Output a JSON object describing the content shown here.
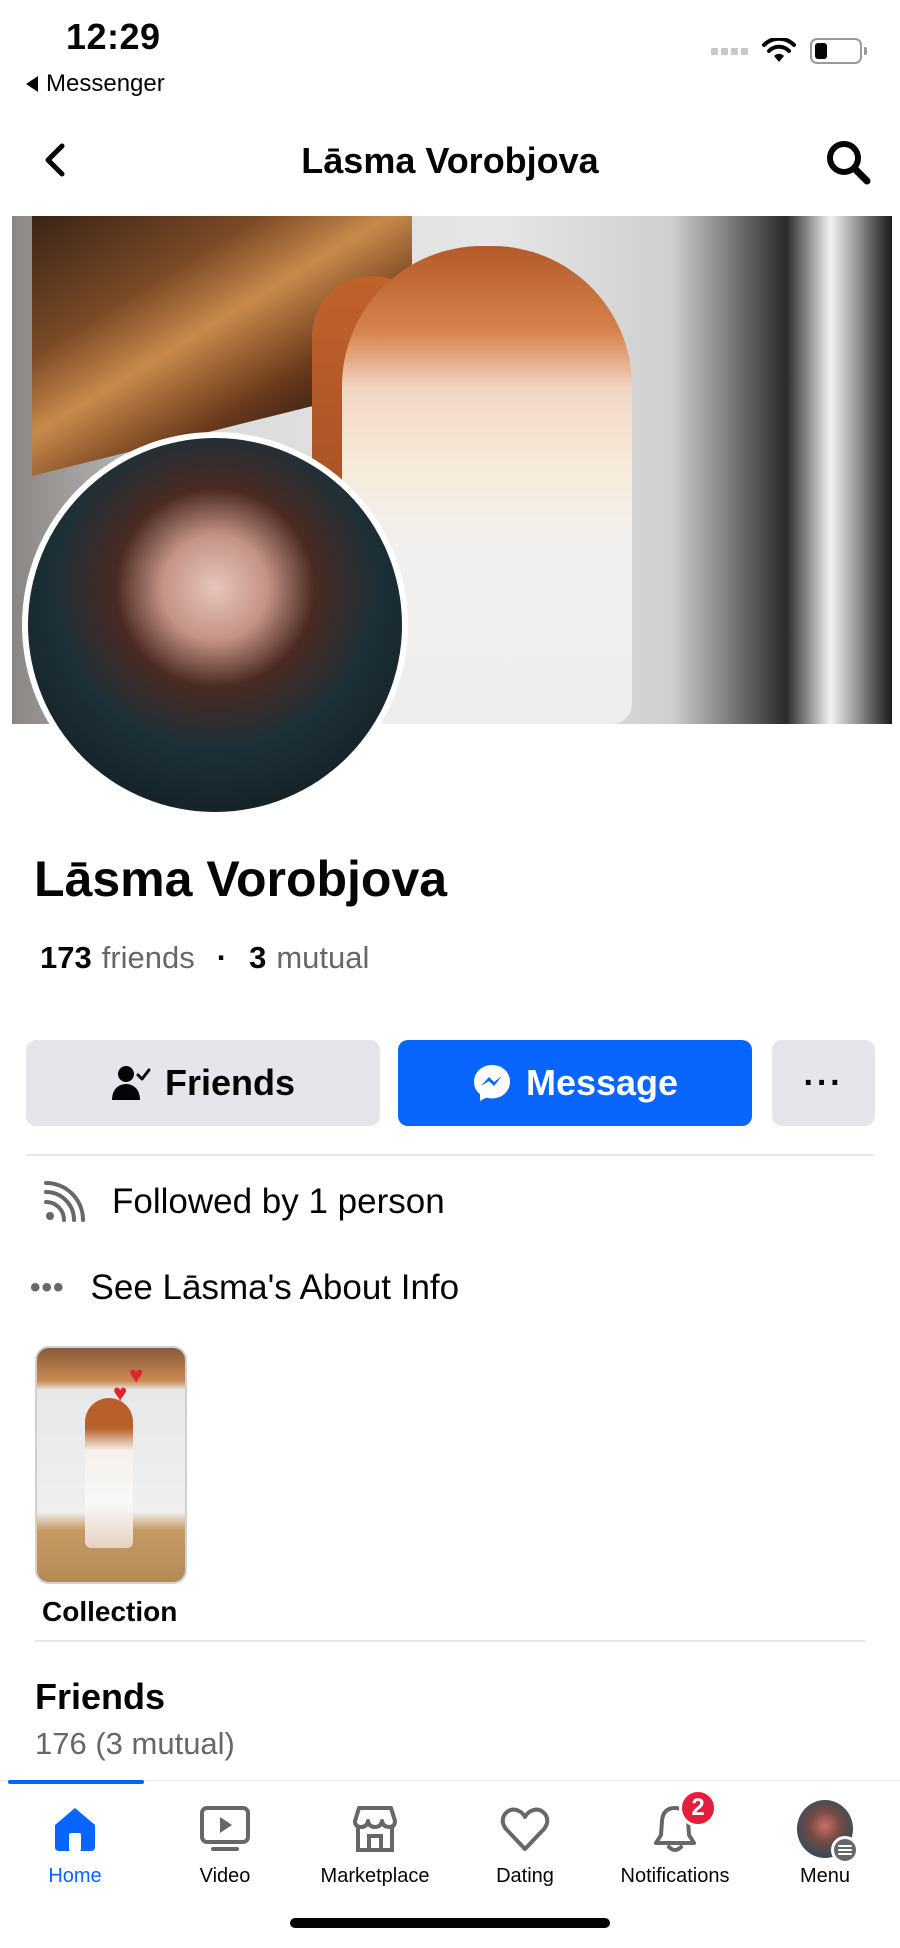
{
  "status_bar": {
    "time": "12:29",
    "back_app": "Messenger"
  },
  "header": {
    "title": "Lāsma Vorobjova"
  },
  "profile": {
    "name": "Lāsma Vorobjova",
    "friends_count": "173",
    "friends_label": "friends",
    "mutual_count": "3",
    "mutual_label": "mutual"
  },
  "actions": {
    "friends_label": "Friends",
    "message_label": "Message",
    "more_label": "···"
  },
  "info": {
    "followed": "Followed by 1 person",
    "about": "See Lāsma's About Info"
  },
  "collection": {
    "label": "Collection"
  },
  "friends_section": {
    "title": "Friends",
    "count": "176 (3 mutual)"
  },
  "tabbar": {
    "items": [
      {
        "label": "Home",
        "icon": "home-icon"
      },
      {
        "label": "Video",
        "icon": "video-icon"
      },
      {
        "label": "Marketplace",
        "icon": "marketplace-icon"
      },
      {
        "label": "Dating",
        "icon": "dating-icon"
      },
      {
        "label": "Notifications",
        "icon": "bell-icon",
        "badge": "2"
      },
      {
        "label": "Menu",
        "icon": "menu-avatar"
      }
    ]
  },
  "colors": {
    "accent": "#0866ff",
    "badge": "#e41e3f",
    "secondary_text": "#65676b",
    "button_gray": "#e4e6eb"
  }
}
